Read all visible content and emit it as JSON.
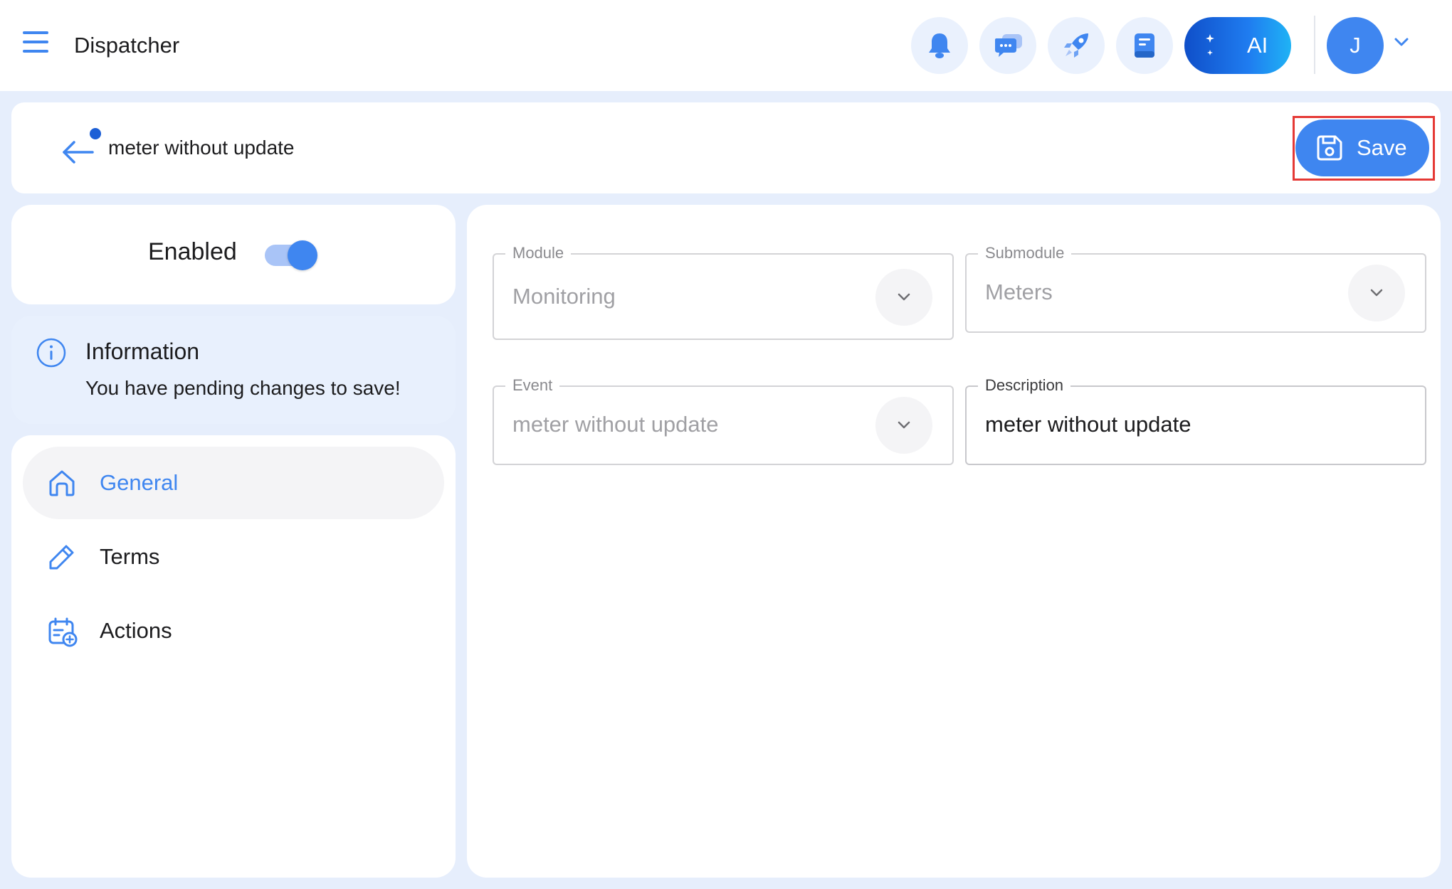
{
  "app": {
    "title": "Dispatcher"
  },
  "topbar": {
    "ai_label": "AI",
    "user_initial": "J"
  },
  "header": {
    "record_title": "meter without update",
    "save_label": "Save"
  },
  "status": {
    "enabled_label": "Enabled",
    "enabled": true
  },
  "info": {
    "title": "Information",
    "message": "You have pending changes to save!"
  },
  "nav": {
    "items": [
      {
        "label": "General",
        "icon": "home-icon",
        "active": true
      },
      {
        "label": "Terms",
        "icon": "pencil-icon",
        "active": false
      },
      {
        "label": "Actions",
        "icon": "calendar-add-icon",
        "active": false
      }
    ]
  },
  "form": {
    "module": {
      "label": "Module",
      "value": "Monitoring"
    },
    "submodule": {
      "label": "Submodule",
      "value": "Meters"
    },
    "event": {
      "label": "Event",
      "value": "meter without update"
    },
    "description": {
      "label": "Description",
      "value": "meter without update"
    }
  },
  "colors": {
    "accent": "#3f86f0",
    "background": "#e6eefc",
    "highlight": "#e53935"
  }
}
